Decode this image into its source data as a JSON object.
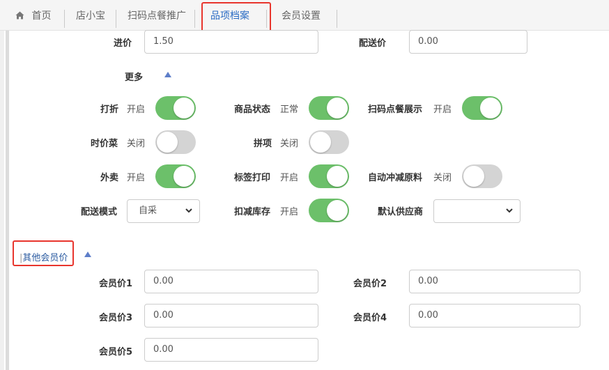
{
  "tabs": [
    {
      "label": "首页",
      "icon": "home-icon"
    },
    {
      "label": "店小宝"
    },
    {
      "label": "扫码点餐推广"
    },
    {
      "label": "品项档案",
      "active": true
    },
    {
      "label": "会员设置"
    }
  ],
  "colors": {
    "accent": "#2a6cc4",
    "toggle_on": "#6cc06a",
    "toggle_off": "#d4d4d4",
    "highlight": "#e8352d"
  },
  "fields": {
    "cost_price": {
      "label": "进价",
      "value": "1.50"
    },
    "delivery_price": {
      "label": "配送价",
      "value": "0.00"
    }
  },
  "more": {
    "label": "更多",
    "expanded": true
  },
  "toggles": {
    "discount": {
      "label": "打折",
      "state": "开启",
      "on": true
    },
    "product_status": {
      "label": "商品状态",
      "state": "正常",
      "on": true
    },
    "scan_display": {
      "label": "扫码点餐展示",
      "state": "开启",
      "on": true
    },
    "market_price": {
      "label": "时价菜",
      "state": "关闭",
      "on": false
    },
    "combo": {
      "label": "拼项",
      "state": "关闭",
      "on": false
    },
    "takeout": {
      "label": "外卖",
      "state": "开启",
      "on": true
    },
    "label_print": {
      "label": "标签打印",
      "state": "开启",
      "on": true
    },
    "auto_deduct": {
      "label": "自动冲减原料",
      "state": "关闭",
      "on": false
    },
    "deduct_stock": {
      "label": "扣减库存",
      "state": "开启",
      "on": true
    }
  },
  "delivery_mode": {
    "label": "配送模式",
    "value": "自采"
  },
  "default_supplier": {
    "label": "默认供应商",
    "value": ""
  },
  "member_section": {
    "title": "其他会员价",
    "expanded": true
  },
  "member_prices": [
    {
      "label": "会员价1",
      "value": "0.00"
    },
    {
      "label": "会员价2",
      "value": "0.00"
    },
    {
      "label": "会员价3",
      "value": "0.00"
    },
    {
      "label": "会员价4",
      "value": "0.00"
    },
    {
      "label": "会员价5",
      "value": "0.00"
    }
  ]
}
